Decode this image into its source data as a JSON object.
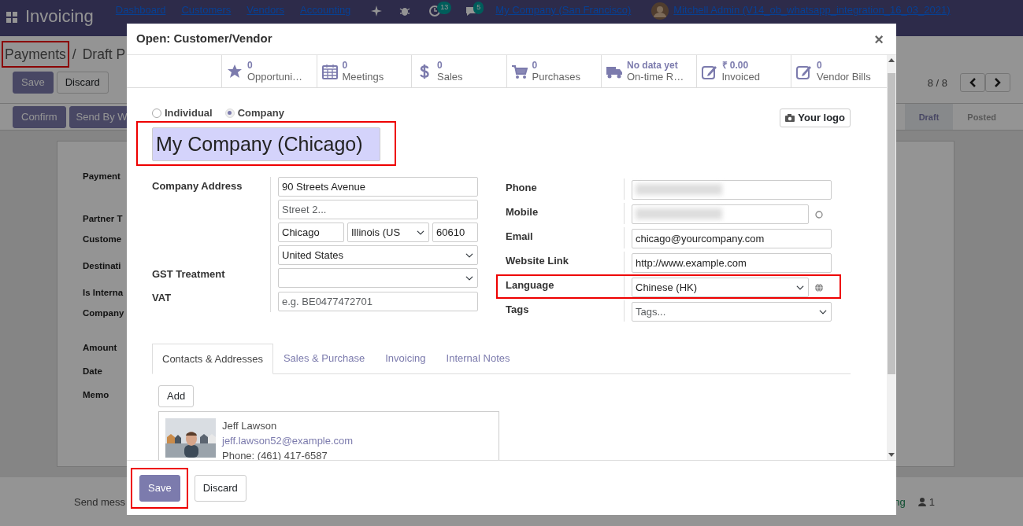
{
  "app": {
    "title": "Invoicing",
    "menu": [
      "Dashboard",
      "Customers",
      "Vendors",
      "Accounting"
    ],
    "badges": [
      "13",
      "5"
    ],
    "company": "My Company (San Francisco)",
    "user": "Mitchell Admin (V14_ob_whatsapp_integration_16_03_2021)"
  },
  "control_panel": {
    "breadcrumb": [
      {
        "label": "Payments",
        "highlighted": true
      },
      {
        "label": "Draft P",
        "highlighted": false
      }
    ],
    "separator": "/",
    "buttons": [
      "Save",
      "Discard"
    ],
    "pager": "8 / 8"
  },
  "status_bar": {
    "buttons": [
      "Confirm",
      "Send By W"
    ],
    "stages": [
      {
        "label": "Draft",
        "selected": true
      },
      {
        "label": "Posted",
        "selected": false
      }
    ]
  },
  "sheet": {
    "labels": [
      "Payment",
      "Partner T",
      "Custome",
      "Destinati",
      "Is Interna",
      "Company",
      "Amount",
      "Date",
      "Memo"
    ]
  },
  "chatter": {
    "send": "Send mess",
    "follow": "ng",
    "followers": "1"
  },
  "modal": {
    "title": "Open: Customer/Vendor",
    "close": "×",
    "stat_buttons": [
      {
        "value": "0",
        "label": "Opportuni…"
      },
      {
        "value": "0",
        "label": "Meetings"
      },
      {
        "value": "0",
        "label": "Sales"
      },
      {
        "value": "0",
        "label": "Purchases"
      },
      {
        "value": "No data yet",
        "label": "On-time R…"
      },
      {
        "value": "₹ 0.00",
        "label": "Invoiced"
      },
      {
        "value": "0",
        "label": "Vendor Bills"
      }
    ],
    "company_type": [
      {
        "label": "Individual",
        "selected": false
      },
      {
        "label": "Company",
        "selected": true
      }
    ],
    "logo_button": "Your logo",
    "name": {
      "value": "My Company (Chicago)",
      "highlighted": true
    },
    "address": {
      "label": "Company Address",
      "street": {
        "value": "90 Streets Avenue"
      },
      "street2": {
        "placeholder": "Street 2..."
      },
      "city": {
        "value": "Chicago"
      },
      "state": {
        "value": "Illinois (US"
      },
      "zip": {
        "value": "60610"
      },
      "country": {
        "value": "United States"
      }
    },
    "left_fields": [
      {
        "label": "GST Treatment",
        "kind": "select"
      },
      {
        "label": "VAT",
        "kind": "input",
        "placeholder": "e.g. BE0477472701"
      }
    ],
    "right_fields": [
      {
        "label": "Phone",
        "kind": "blurred"
      },
      {
        "label": "Mobile",
        "kind": "blurred-chat"
      },
      {
        "label": "Email",
        "kind": "input",
        "value": "chicago@yourcompany.com"
      },
      {
        "label": "Website Link",
        "kind": "input",
        "value": "http://www.example.com"
      },
      {
        "label": "Language",
        "kind": "select-globe",
        "value": "Chinese (HK)",
        "highlighted": true
      },
      {
        "label": "Tags",
        "kind": "tags",
        "placeholder": "Tags..."
      }
    ],
    "tabs": [
      {
        "label": "Contacts & Addresses",
        "selected": true
      },
      {
        "label": "Sales & Purchase",
        "selected": false
      },
      {
        "label": "Invoicing",
        "selected": false
      },
      {
        "label": "Internal Notes",
        "selected": false
      }
    ],
    "add_button": "Add",
    "contacts": [
      {
        "name": "Jeff Lawson",
        "email": "jeff.lawson52@example.com",
        "phone": "Phone: (461) 417-6587",
        "kind": "picture"
      }
    ],
    "footer": [
      {
        "label": "Save",
        "primary": true,
        "highlighted": true
      },
      {
        "label": "Discard",
        "primary": false,
        "highlighted": false
      }
    ]
  }
}
